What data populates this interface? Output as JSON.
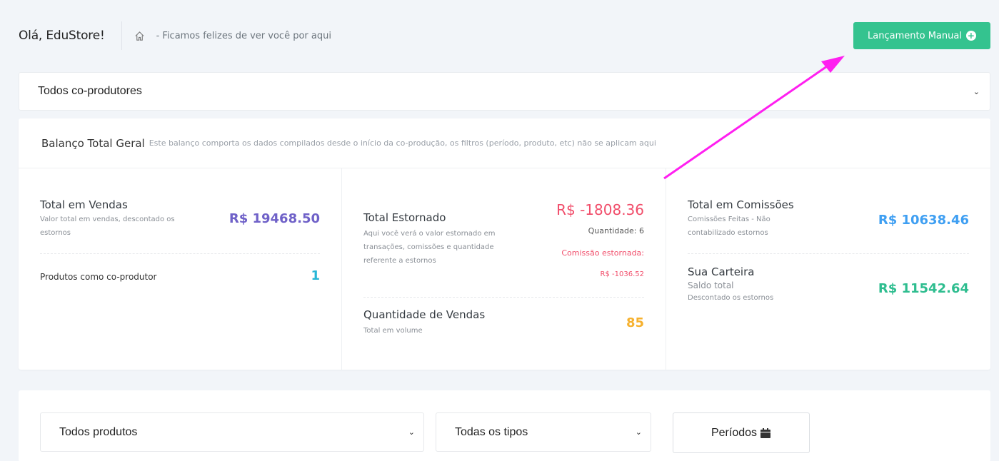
{
  "header": {
    "greeting": "Olá, EduStore!",
    "home_icon": "home-icon",
    "subtitle": "- Ficamos felizes de ver você por aqui",
    "manual_button": "Lançamento Manual"
  },
  "coproducer_select": {
    "value": "Todos co-produtores"
  },
  "balance": {
    "title": "Balanço Total Geral",
    "description": "Este balanço comporta os dados compilados desde o início da co-produção, os filtros (período, produto, etc) não se aplicam aqui",
    "total_sales": {
      "title": "Total em Vendas",
      "desc": "Valor total em vendas, descontado os estornos",
      "value": "R$ 19468.50"
    },
    "products": {
      "label": "Produtos como co-produtor",
      "value": "1"
    },
    "refunded": {
      "title": "Total Estornado",
      "desc": "Aqui você verá o valor estornado em transações, comissões e quantidade referente a estornos",
      "value": "R$ -1808.36",
      "quantity": "Quantidade: 6",
      "commission_label": "Comissão estornada:",
      "commission_value": "R$ -1036.52"
    },
    "sales_qty": {
      "title": "Quantidade de Vendas",
      "desc": "Total em volume",
      "value": "85"
    },
    "commissions": {
      "title": "Total em Comissões",
      "desc": "Comissões Feitas - Não contabilizado estornos",
      "value": "R$ 10638.46"
    },
    "wallet": {
      "title": "Sua Carteira",
      "subtitle": "Saldo total",
      "desc": "Descontado os estornos",
      "value": "R$ 11542.64"
    }
  },
  "filters": {
    "products_select": "Todos produtos",
    "types_select": "Todas os tipos",
    "period_button": "Períodos"
  },
  "colors": {
    "primary_green": "#34c38f",
    "purple": "#6f61c8",
    "red": "#f14d6a",
    "yellow": "#f6b12f",
    "blue": "#3f9ff2",
    "annotation_arrow": "#ff1ff0"
  }
}
